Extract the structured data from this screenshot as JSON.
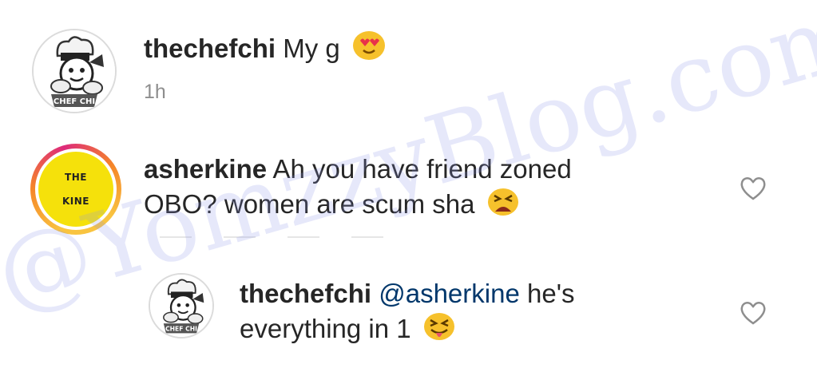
{
  "comments": [
    {
      "username": "thechefchi",
      "text": "My g",
      "time": "1h",
      "emoji": "smiling-face-with-heart-eyes",
      "avatar_text": "CHEF CHI"
    },
    {
      "username": "asherkine",
      "text_line1": "Ah you have friend zoned",
      "text_line2": "OBO? women are scum sha",
      "emoji": "tired-face",
      "avatar_line1": "THE",
      "avatar_line2": "KINE"
    }
  ],
  "reply": {
    "username": "thechefchi",
    "mention": "@asherkine",
    "text_line1": "he's",
    "text_line2": "everything in 1",
    "emoji": "squinting-face-with-tongue",
    "avatar_text": "CHEF CHI"
  },
  "watermark": "@YomzzyBlog.com",
  "colors": {
    "text": "#262626",
    "mention": "#00376b",
    "timestamp": "#8e8e8e",
    "story_ring": "#f58529",
    "kine_avatar_bg": "#f5e10b",
    "watermark": "#8c96e6"
  }
}
